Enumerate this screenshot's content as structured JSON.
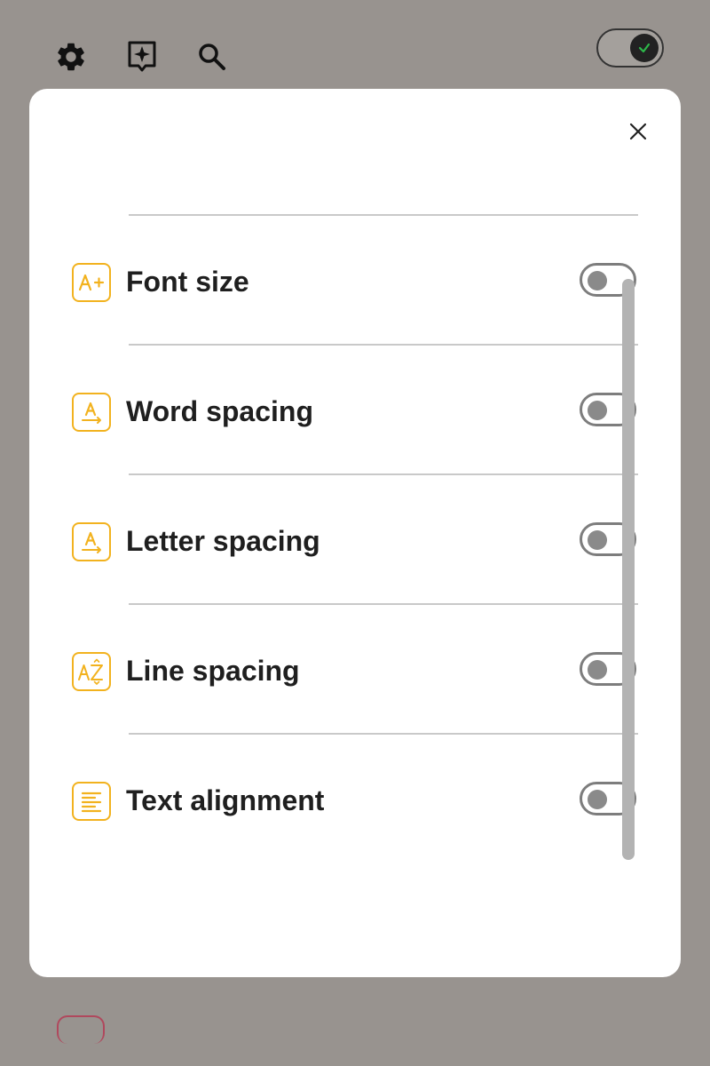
{
  "topbar": {
    "icons": [
      "gear-icon",
      "sparkle-bookmark-icon",
      "search-icon"
    ],
    "master_toggle": {
      "state": "on",
      "icon": "check-icon",
      "check_color": "#2db84a"
    }
  },
  "modal": {
    "close_icon": "close-icon",
    "rows": [
      {
        "label": "Font size",
        "icon": "font-size-icon",
        "icon_text": "A+",
        "enabled": false
      },
      {
        "label": "Word spacing",
        "icon": "word-spacing-icon",
        "icon_text": "A",
        "enabled": false
      },
      {
        "label": "Letter spacing",
        "icon": "letter-spacing-icon",
        "icon_text": "A",
        "enabled": false
      },
      {
        "label": "Line spacing",
        "icon": "line-spacing-icon",
        "icon_text": "AZ",
        "enabled": false
      },
      {
        "label": "Text alignment",
        "icon": "text-align-icon",
        "icon_text": "",
        "enabled": false
      }
    ]
  },
  "colors": {
    "accent": "#f2b21e",
    "backdrop": "#98938f",
    "toggle_border": "#7d7d7d"
  }
}
